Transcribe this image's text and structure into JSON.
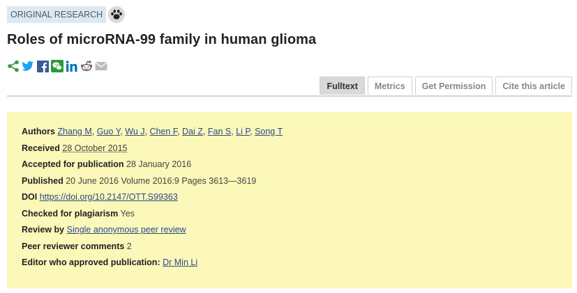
{
  "header": {
    "badge": "ORIGINAL RESEARCH",
    "title": "Roles of microRNA-99 family in human glioma"
  },
  "share": [
    "share-icon",
    "twitter-icon",
    "facebook-icon",
    "wechat-icon",
    "linkedin-icon",
    "reddit-icon",
    "email-icon"
  ],
  "tabs": [
    {
      "label": "Fulltext",
      "active": true
    },
    {
      "label": "Metrics",
      "active": false
    },
    {
      "label": "Get Permission",
      "active": false
    },
    {
      "label": "Cite this article",
      "active": false
    }
  ],
  "info": {
    "authors_label": "Authors",
    "authors": [
      "Zhang M",
      "Guo Y",
      "Wu J",
      "Chen F",
      "Dai Z",
      "Fan S",
      "Li P",
      "Song T"
    ],
    "received_label": "Received",
    "received": "28 October 2015",
    "accepted_label": "Accepted for publication",
    "accepted": "28 January 2016",
    "published_label": "Published",
    "published": "20 June 2016 Volume 2016:9 Pages 3613—3619",
    "doi_label": "DOI",
    "doi": "https://doi.org/10.2147/OTT.S99363",
    "plagiarism_label": "Checked for plagiarism",
    "plagiarism": "Yes",
    "review_label": "Review by",
    "review": "Single anonymous peer review",
    "comments_label": "Peer reviewer comments",
    "comments": "2",
    "editor_label": "Editor who approved publication:",
    "editor": "Dr Min Li"
  },
  "colors": {
    "panel": "#fbf8b9",
    "badge": "#dde9f2",
    "link": "#2a4a8a"
  }
}
